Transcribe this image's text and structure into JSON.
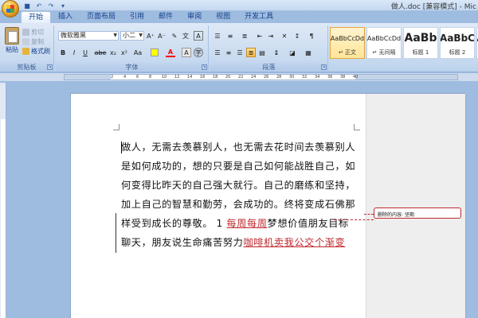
{
  "window": {
    "title": "做人.doc [兼容模式] - Mic"
  },
  "tabs": [
    "开始",
    "插入",
    "页面布局",
    "引用",
    "邮件",
    "审阅",
    "视图",
    "开发工具"
  ],
  "clipboard": {
    "paste_label": "粘贴",
    "cut_label": "剪切",
    "copy_label": "复制",
    "format_painter_label": "格式刷",
    "group_label": "剪贴板"
  },
  "font": {
    "name": "微软雅黑",
    "size": "小二",
    "group_label": "字体",
    "bold": "B",
    "italic": "I",
    "underline": "U",
    "strike": "abe",
    "sub": "x₂",
    "sup": "x²",
    "case": "Aa",
    "grow": "A⁺",
    "shrink": "A⁻",
    "highlight_color": "#ffff00",
    "font_color": "#ff0000"
  },
  "paragraph": {
    "group_label": "段落"
  },
  "styles": [
    {
      "sample": "AaBbCcDd",
      "name": "↵ 正文",
      "active": true
    },
    {
      "sample": "AaBbCcDd",
      "name": "↵ 无间隔",
      "active": false
    },
    {
      "sample": "AaBb",
      "name": "标题 1",
      "active": false
    },
    {
      "sample": "AaBbC",
      "name": "标题 2",
      "active": false
    },
    {
      "sample": "A",
      "name": "",
      "active": false
    }
  ],
  "ruler": {
    "ticks": [
      "2",
      "4",
      "6",
      "8",
      "10",
      "12",
      "14",
      "16",
      "18",
      "20",
      "22",
      "24",
      "26",
      "28",
      "30",
      "32",
      "34",
      "36",
      "38",
      "40"
    ]
  },
  "document": {
    "lines": [
      "做人，无需去羡慕别人，也无需去花时间去羡慕别人",
      "是如何成功的，想的只要是自己如何能战胜自己，如",
      "何变得比昨天的自己强大就行。自己的磨练和坚持，",
      "加上自己的智慧和勤劳，会成功的。终将变成石佛那"
    ],
    "line5_prefix": "样受到成长的尊敬。 1 ",
    "line5_insert": "每周每周",
    "line5_suffix": "梦想价值朋友目标",
    "line6_prefix": "聊天，朋友说生命痛苦努力",
    "line6_insert": "咖啡机卖我公交个渐变"
  },
  "comment": {
    "text": "删除的内容: 坚期"
  }
}
